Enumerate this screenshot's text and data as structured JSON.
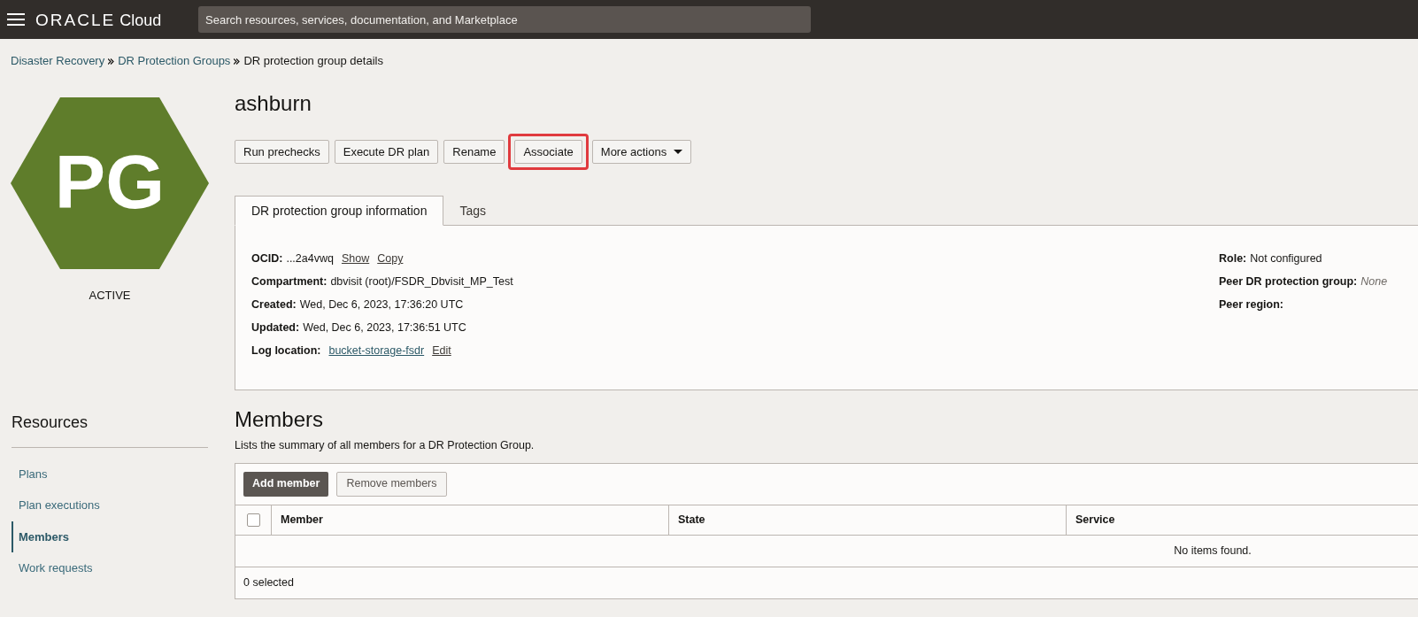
{
  "header": {
    "brand": "ORACLE",
    "product": "Cloud",
    "search": {
      "placeholder": "Search resources, services, documentation, and Marketplace"
    }
  },
  "breadcrumbs": [
    {
      "label": "Disaster Recovery",
      "link": true
    },
    {
      "label": "DR Protection Groups",
      "link": true
    },
    {
      "label": "DR protection group details",
      "link": false
    }
  ],
  "badge": {
    "text": "PG",
    "status": "ACTIVE"
  },
  "resources": {
    "title": "Resources",
    "items": [
      {
        "label": "Plans",
        "selected": false
      },
      {
        "label": "Plan executions",
        "selected": false
      },
      {
        "label": "Members",
        "selected": true
      },
      {
        "label": "Work requests",
        "selected": false
      }
    ]
  },
  "title": "ashburn",
  "actions": [
    {
      "label": "Run prechecks",
      "highlighted": false,
      "dropdown": false
    },
    {
      "label": "Execute DR plan",
      "highlighted": false,
      "dropdown": false
    },
    {
      "label": "Rename",
      "highlighted": false,
      "dropdown": false
    },
    {
      "label": "Associate",
      "highlighted": true,
      "dropdown": false
    },
    {
      "label": "More actions",
      "highlighted": false,
      "dropdown": true
    }
  ],
  "tabs": [
    {
      "label": "DR protection group information",
      "selected": true
    },
    {
      "label": "Tags",
      "selected": false
    }
  ],
  "info_left": [
    {
      "label": "OCID:",
      "value": "...2a4vwq",
      "links": [
        "Show",
        "Copy"
      ]
    },
    {
      "label": "Compartment:",
      "value": "dbvisit (root)/FSDR_Dbvisit_MP_Test"
    },
    {
      "label": "Created:",
      "value": "Wed, Dec 6, 2023, 17:36:20 UTC"
    },
    {
      "label": "Updated:",
      "value": "Wed, Dec 6, 2023, 17:36:51 UTC"
    },
    {
      "label": "Log location:",
      "links": [
        "bucket-storage-fsdr",
        "Edit"
      ]
    }
  ],
  "info_right": [
    {
      "label": "Role:",
      "value": "Not configured",
      "italic": false
    },
    {
      "label": "Peer DR protection group:",
      "value": "None",
      "italic": true
    },
    {
      "label": "Peer region:"
    }
  ],
  "members": {
    "title": "Members",
    "description": "Lists the summary of all members for a DR Protection Group.",
    "buttons": [
      {
        "label": "Add member",
        "primary": true
      },
      {
        "label": "Remove members",
        "primary": false
      }
    ],
    "select_all_checked": false,
    "columns": [
      "Member",
      "State",
      "Service"
    ],
    "empty": "No items found.",
    "footer": "0 selected"
  }
}
